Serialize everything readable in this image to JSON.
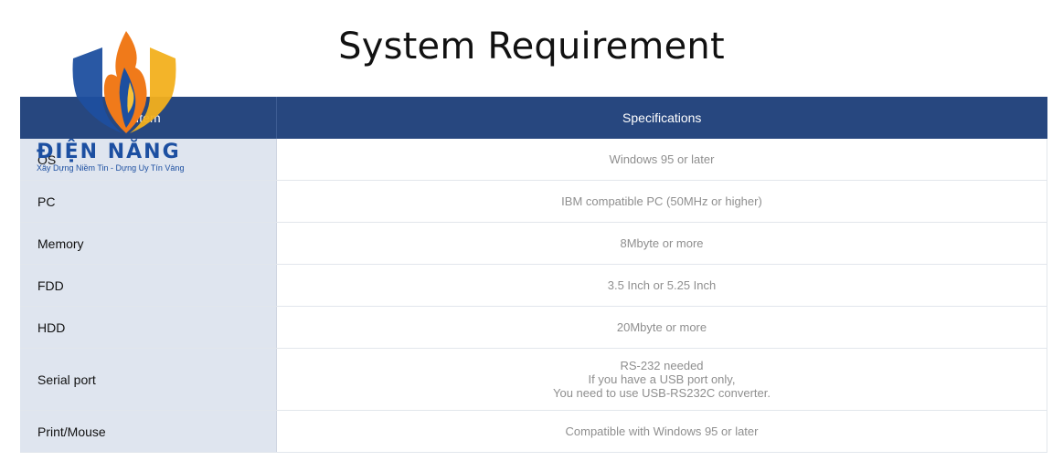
{
  "page": {
    "title": "System Requirement"
  },
  "logo": {
    "brand": "ĐIỆN NĂNG",
    "tagline": "Xây Dựng Niềm Tin - Dựng Uy Tín Vàng"
  },
  "table": {
    "headers": [
      "Item",
      "Specifications"
    ],
    "rows": [
      {
        "item": "OS",
        "spec": [
          "Windows 95 or later"
        ]
      },
      {
        "item": "PC",
        "spec": [
          "IBM compatible PC (50MHz or higher)"
        ]
      },
      {
        "item": "Memory",
        "spec": [
          "8Mbyte or more"
        ]
      },
      {
        "item": "FDD",
        "spec": [
          "3.5 Inch or 5.25 Inch"
        ]
      },
      {
        "item": "HDD",
        "spec": [
          "20Mbyte or more"
        ]
      },
      {
        "item": "Serial port",
        "spec": [
          "RS-232 needed",
          "If you have a USB port only,",
          "You need to use USB-RS232C converter."
        ]
      },
      {
        "item": "Print/Mouse",
        "spec": [
          "Compatible with Windows 95 or later"
        ]
      }
    ]
  },
  "colors": {
    "header_bg": "#27477f",
    "item_bg": "#dfe5ef",
    "spec_text": "#8f8f8f"
  }
}
